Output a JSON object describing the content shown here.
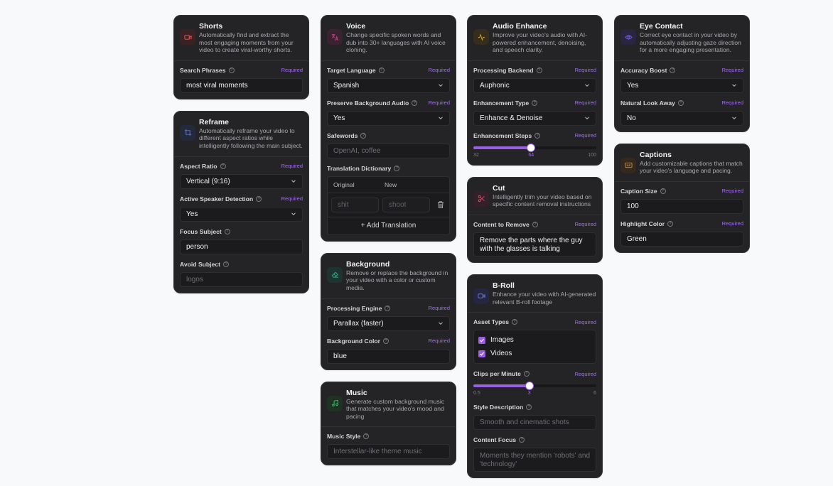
{
  "labels": {
    "required": "Required",
    "help": "?"
  },
  "shorts": {
    "title": "Shorts",
    "desc": "Automatically find and extract the most engaging moments from your video to create viral-worthy shorts.",
    "search_label": "Search Phrases",
    "search_value": "most viral moments"
  },
  "reframe": {
    "title": "Reframe",
    "desc": "Automatically reframe your video to different aspect ratios while intelligently following the main subject.",
    "aspect_label": "Aspect Ratio",
    "aspect_value": "Vertical (9:16)",
    "speaker_label": "Active Speaker Detection",
    "speaker_value": "Yes",
    "focus_label": "Focus Subject",
    "focus_value": "person",
    "avoid_label": "Avoid Subject",
    "avoid_placeholder": "logos"
  },
  "voice": {
    "title": "Voice",
    "desc": "Change specific spoken words and dub into 30+ languages with AI voice cloning.",
    "target_label": "Target Language",
    "target_value": "Spanish",
    "preserve_label": "Preserve Background Audio",
    "preserve_value": "Yes",
    "safewords_label": "Safewords",
    "safewords_placeholder": "OpenAI, coffee",
    "dict_label": "Translation Dictionary",
    "dict_col_original": "Original",
    "dict_col_new": "New",
    "dict_original_placeholder": "shit",
    "dict_new_placeholder": "shoot",
    "add_translation": "+ Add Translation"
  },
  "background": {
    "title": "Background",
    "desc": "Remove or replace the background in your video with a color or custom media.",
    "engine_label": "Processing Engine",
    "engine_value": "Parallax (faster)",
    "color_label": "Background Color",
    "color_value": "blue"
  },
  "music": {
    "title": "Music",
    "desc": "Generate custom background music that matches your video's mood and pacing",
    "style_label": "Music Style",
    "style_placeholder": "Interstellar-like theme music"
  },
  "audio": {
    "title": "Audio Enhance",
    "desc": "Improve your video's audio with AI-powered enhancement, denoising, and speech clarity.",
    "backend_label": "Processing Backend",
    "backend_value": "Auphonic",
    "type_label": "Enhancement Type",
    "type_value": "Enhance & Denoise",
    "steps_label": "Enhancement Steps",
    "steps_min": "32",
    "steps_value": "64",
    "steps_max": "100",
    "steps_fraction": 0.47
  },
  "cut": {
    "title": "Cut",
    "desc": "Intelligently trim your video based on specific content removal instructions",
    "remove_label": "Content to Remove",
    "remove_value": "Remove the parts where the guy with the glasses is talking"
  },
  "broll": {
    "title": "B-Roll",
    "desc": "Enhance your video with AI-generated relevant B-roll footage",
    "asset_label": "Asset Types",
    "asset_images": "Images",
    "asset_videos": "Videos",
    "clips_label": "Clips per Minute",
    "clips_min": "0.5",
    "clips_value": "3",
    "clips_max": "6",
    "clips_fraction": 0.455,
    "style_label": "Style Description",
    "style_placeholder": "Smooth and cinematic shots",
    "focus_label": "Content Focus",
    "focus_placeholder": "Moments they mention 'robots' and 'technology'"
  },
  "eye": {
    "title": "Eye Contact",
    "desc": "Correct eye contact in your video by automatically adjusting gaze direction for a more engaging presentation.",
    "boost_label": "Accuracy Boost",
    "boost_value": "Yes",
    "lookaway_label": "Natural Look Away",
    "lookaway_value": "No"
  },
  "captions": {
    "title": "Captions",
    "desc": "Add customizable captions that match your video's language and pacing.",
    "size_label": "Caption Size",
    "size_value": "100",
    "highlight_label": "Highlight Color",
    "highlight_value": "Green"
  },
  "colors": {
    "accent": "#9b5de5",
    "shorts_icon": "#e0524a",
    "reframe_icon": "#4a6fe0",
    "voice_icon": "#c84b8a",
    "background_icon": "#2fb38a",
    "music_icon": "#3fbf6a",
    "audio_icon": "#d4a02a",
    "cut_icon": "#d0506a",
    "broll_icon": "#6a6fe0",
    "eye_icon": "#7a5fe0",
    "captions_icon": "#d4902a"
  }
}
